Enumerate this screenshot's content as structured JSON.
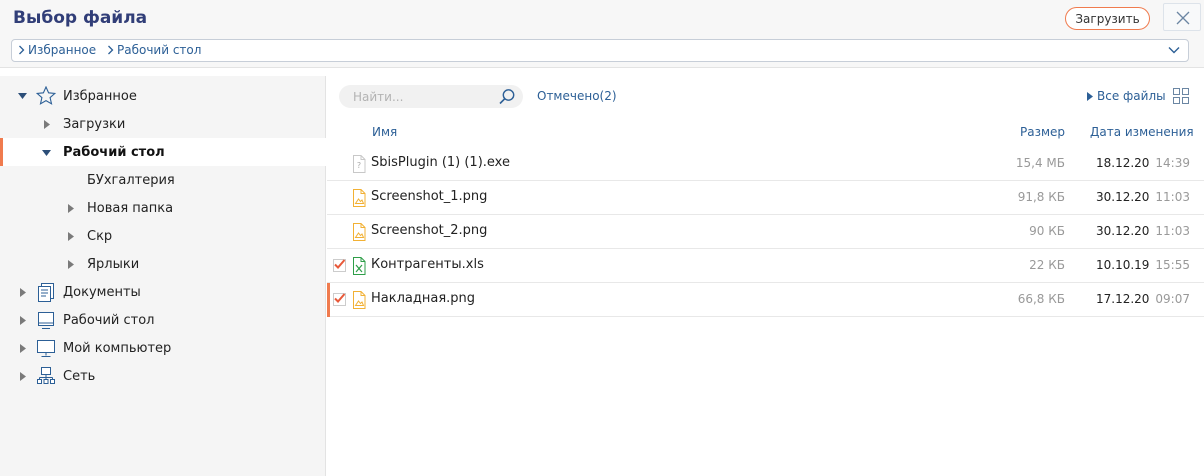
{
  "dialog": {
    "title": "Выбор файла",
    "upload_label": "Загрузить"
  },
  "breadcrumb": {
    "items": [
      "Избранное",
      "Рабочий стол"
    ]
  },
  "sidebar": {
    "items": [
      {
        "label": "Избранное",
        "icon": "star-icon",
        "state": "expanded"
      },
      {
        "label": "Загрузки",
        "state": "collapsed"
      },
      {
        "label": "Рабочий стол",
        "state": "expanded",
        "active": true
      },
      {
        "label": "БУхгалтерия"
      },
      {
        "label": "Новая папка",
        "state": "collapsed"
      },
      {
        "label": "Скр",
        "state": "collapsed"
      },
      {
        "label": "Ярлыки",
        "state": "collapsed"
      },
      {
        "label": "Документы",
        "icon": "documents-icon",
        "state": "collapsed"
      },
      {
        "label": "Рабочий стол",
        "icon": "desktop-icon",
        "state": "collapsed"
      },
      {
        "label": "Мой компьютер",
        "icon": "computer-icon",
        "state": "collapsed"
      },
      {
        "label": "Сеть",
        "icon": "network-icon",
        "state": "collapsed"
      }
    ]
  },
  "toolbar": {
    "search_placeholder": "Найти...",
    "marked_label": "Отмечено(2)",
    "all_files_label": "Все файлы"
  },
  "columns": {
    "name": "Имя",
    "size": "Размер",
    "modified": "Дата изменения"
  },
  "files": [
    {
      "name": "SbisPlugin (1) (1).exe",
      "size": "15,4 МБ",
      "date": "18.12.20",
      "time": "14:39",
      "type": "unknown-file-icon",
      "checked": false
    },
    {
      "name": "Screenshot_1.png",
      "size": "91,8 КБ",
      "date": "30.12.20",
      "time": "11:03",
      "type": "image-file-icon",
      "checked": false
    },
    {
      "name": "Screenshot_2.png",
      "size": "90 КБ",
      "date": "30.12.20",
      "time": "11:03",
      "type": "image-file-icon",
      "checked": false
    },
    {
      "name": "Контрагенты.xls",
      "size": "22 КБ",
      "date": "10.10.19",
      "time": "15:55",
      "type": "excel-file-icon",
      "checked": true
    },
    {
      "name": "Накладная.png",
      "size": "66,8 КБ",
      "date": "17.12.20",
      "time": "09:07",
      "type": "image-file-icon",
      "checked": true,
      "selected": true
    }
  ],
  "colors": {
    "accent": "#f07b4e",
    "link": "#2c5f96",
    "title": "#313e78"
  }
}
